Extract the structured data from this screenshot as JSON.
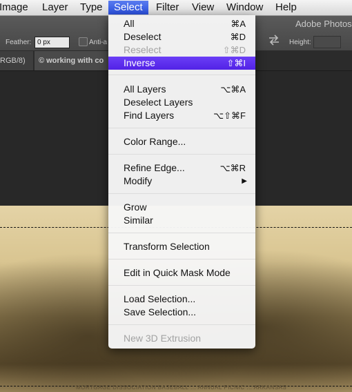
{
  "menubar": {
    "items": [
      "Image",
      "Layer",
      "Type",
      "Select",
      "Filter",
      "View",
      "Window",
      "Help"
    ],
    "active": "Select"
  },
  "options_bar": {
    "app_title": "Adobe Photos",
    "feather_label": "Feather:",
    "feather_value": "0 px",
    "antialias_label": "Anti-a",
    "height_label": "Height:"
  },
  "tabs": {
    "tab1_label": "RGB/8)",
    "tab2_label": "working with co"
  },
  "select_menu": {
    "all": {
      "label": "All",
      "shortcut": "⌘A"
    },
    "deselect": {
      "label": "Deselect",
      "shortcut": "⌘D"
    },
    "reselect": {
      "label": "Reselect",
      "shortcut": "⇧⌘D"
    },
    "inverse": {
      "label": "Inverse",
      "shortcut": "⇧⌘I"
    },
    "all_layers": {
      "label": "All Layers",
      "shortcut": "⌥⌘A"
    },
    "deselect_layers": {
      "label": "Deselect Layers"
    },
    "find_layers": {
      "label": "Find Layers",
      "shortcut": "⌥⇧⌘F"
    },
    "color_range": {
      "label": "Color Range..."
    },
    "refine_edge": {
      "label": "Refine Edge...",
      "shortcut": "⌥⌘R"
    },
    "modify": {
      "label": "Modify",
      "submenu_glyph": "▶"
    },
    "grow": {
      "label": "Grow"
    },
    "similar": {
      "label": "Similar"
    },
    "transform_selection": {
      "label": "Transform Selection"
    },
    "quick_mask": {
      "label": "Edit in Quick Mask Mode"
    },
    "load_selection": {
      "label": "Load Selection..."
    },
    "save_selection": {
      "label": "Save Selection..."
    },
    "new_3d_extrusion": {
      "label": "New 3D Extrusion"
    }
  },
  "photo": {
    "caption": "MORTGAGE DISSOCIATION BASEBALL ... ANNUAL PICNIC ... ARKANSAS"
  },
  "colors": {
    "highlight": "#5a2ef0",
    "menubar_active": "#3b5fe6",
    "photo_sepia": "#d9c591"
  }
}
